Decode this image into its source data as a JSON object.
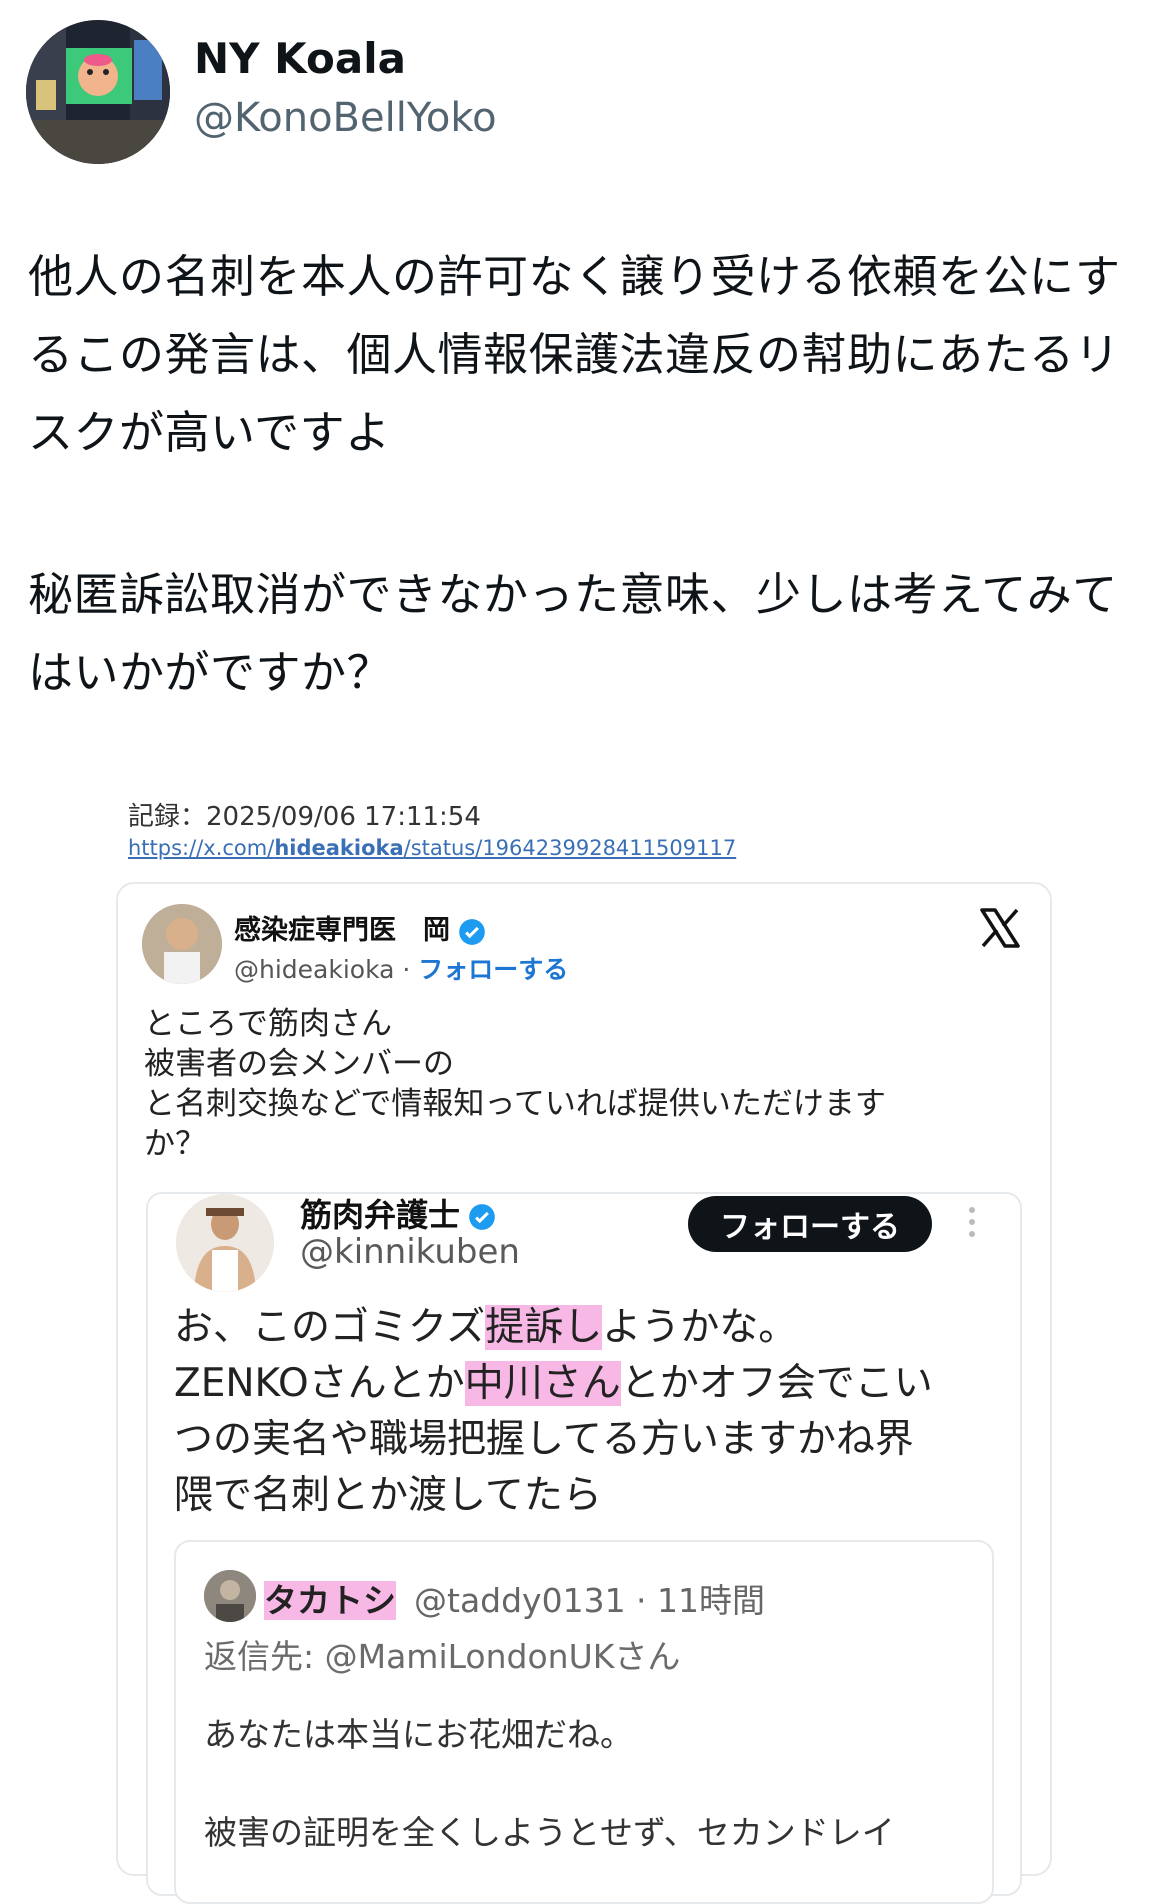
{
  "header": {
    "display_name": "NY Koala",
    "handle": "@KonoBellYoko"
  },
  "tweet": {
    "paragraph_1": "他人の名刺を本人の許可なく譲り受ける依頼を公にするこの発言は、個人情報保護法違反の幇助にあたるリスクが高いですよ",
    "paragraph_2": "秘匿訴訟取消ができなかった意味、少しは考えてみてはいかがですか？"
  },
  "embedded": {
    "record_label": "記録：2025/09/06 17:11:54",
    "url_prefix": "https://x.com/",
    "url_user": "hideakioka",
    "url_suffix": "/status/1964239928411509117",
    "card1": {
      "name": "感染症専門医　岡",
      "handle": "@hideakioka",
      "separator": " · ",
      "follow": "フォローする",
      "lines": [
        "ところで筋肉さん",
        "被害者の会メンバーの",
        "と名刺交換などで情報知っていれば提供いただけます",
        "か？"
      ]
    },
    "card2": {
      "name": "筋肉弁護士",
      "handle": "@kinnikuben",
      "follow_button": "フォローする",
      "line1_a": "お、このゴミクズ",
      "line1_hl": "提訴し",
      "line1_b": "ようかな。",
      "line2_a": "ZENKOさんとか",
      "line2_hl": "中川さん",
      "line2_b": "とかオフ会でこい",
      "line3": "つの実名や職場把握してる方いますかね界",
      "line4": "隈で名刺とか渡してたら"
    },
    "card3": {
      "name": "タカトシ",
      "meta": "@taddy0131 · 11時間",
      "reply_to": "返信先: @MamiLondonUKさん",
      "p1": "あなたは本当にお花畑だね。",
      "p2": "被害の証明を全くしようとせず、セカンドレイ"
    }
  },
  "colors": {
    "text": "#0f1419",
    "muted": "#536471",
    "link": "#1d76d2",
    "highlight": "#f7b8e6",
    "verified": "#1d9bf0"
  }
}
